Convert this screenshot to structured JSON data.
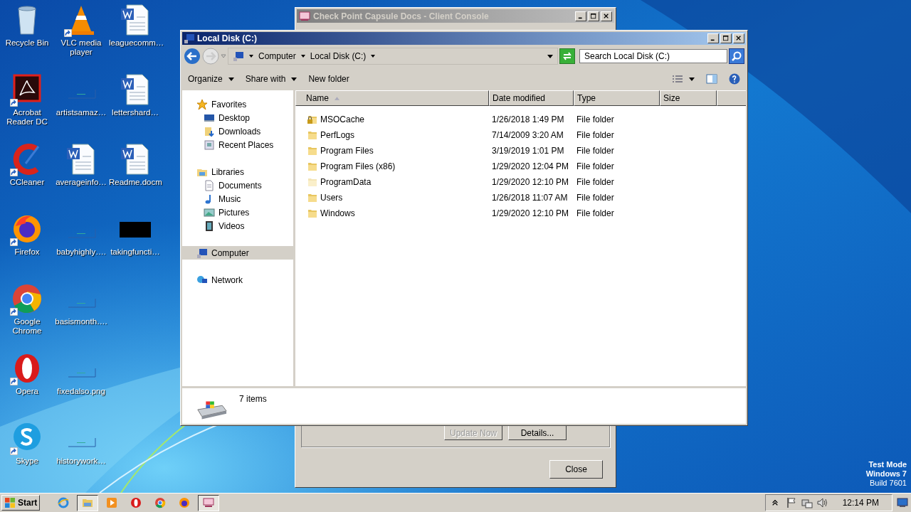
{
  "desktop_icons": [
    {
      "label": "Recycle Bin",
      "kind": "recycle",
      "shortcut": false
    },
    {
      "label": "Acrobat Reader DC",
      "kind": "acrobat",
      "shortcut": true
    },
    {
      "label": "CCleaner",
      "kind": "ccleaner",
      "shortcut": true
    },
    {
      "label": "Firefox",
      "kind": "firefox",
      "shortcut": true
    },
    {
      "label": "Google Chrome",
      "kind": "chrome",
      "shortcut": true
    },
    {
      "label": "Opera",
      "kind": "opera",
      "shortcut": true
    },
    {
      "label": "Skype",
      "kind": "skype",
      "shortcut": true
    },
    {
      "label": "VLC media player",
      "kind": "vlc",
      "shortcut": true
    },
    {
      "label": "artistsamaz…",
      "kind": "blank",
      "shortcut": false
    },
    {
      "label": "averageinfo…",
      "kind": "word",
      "shortcut": false
    },
    {
      "label": "babyhighly….",
      "kind": "blank",
      "shortcut": false
    },
    {
      "label": "basismonth….",
      "kind": "blank",
      "shortcut": false
    },
    {
      "label": "fixedalso.png",
      "kind": "blank",
      "shortcut": false
    },
    {
      "label": "historywork…",
      "kind": "blank",
      "shortcut": false
    },
    {
      "label": "leaguecomm…",
      "kind": "word",
      "shortcut": false
    },
    {
      "label": "lettershard…",
      "kind": "word",
      "shortcut": false
    },
    {
      "label": "Readme.docm",
      "kind": "word",
      "shortcut": false
    },
    {
      "label": "takingfuncti…",
      "kind": "black",
      "shortcut": false
    }
  ],
  "back_window": {
    "title": "Check Point Capsule Docs - Client Console",
    "buttons": [
      {
        "label": "Update Now",
        "disabled": true
      },
      {
        "label": "Details...",
        "disabled": false
      }
    ],
    "close_button": "Close"
  },
  "explorer": {
    "title": "Local Disk (C:)",
    "breadcrumb": [
      "Computer",
      "Local Disk (C:)"
    ],
    "search": {
      "placeholder": "Search Local Disk (C:)"
    },
    "toolbar": [
      {
        "label": "Organize",
        "dropdown": true
      },
      {
        "label": "Share with",
        "dropdown": true
      },
      {
        "label": "New folder",
        "dropdown": false
      }
    ],
    "nav": [
      {
        "label": "Favorites",
        "kind": "star",
        "selected": false,
        "children": [
          {
            "label": "Desktop",
            "kind": "desktop",
            "selected": false
          },
          {
            "label": "Downloads",
            "kind": "downloads",
            "selected": false
          },
          {
            "label": "Recent Places",
            "kind": "recent",
            "selected": false
          }
        ]
      },
      {
        "label": "Libraries",
        "kind": "library",
        "selected": false,
        "children": [
          {
            "label": "Documents",
            "kind": "documents",
            "selected": false
          },
          {
            "label": "Music",
            "kind": "music",
            "selected": false
          },
          {
            "label": "Pictures",
            "kind": "pictures",
            "selected": false
          },
          {
            "label": "Videos",
            "kind": "videos",
            "selected": false
          }
        ]
      },
      {
        "label": "Computer",
        "kind": "computer",
        "selected": true
      },
      {
        "label": "Network",
        "kind": "network",
        "selected": false
      }
    ],
    "columns": [
      {
        "label": "Name",
        "sorted": true
      },
      {
        "label": "Date modified",
        "sorted": false
      },
      {
        "label": "Type",
        "sorted": false
      },
      {
        "label": "Size",
        "sorted": false
      }
    ],
    "rows": [
      {
        "name": "MSOCache",
        "date": "1/26/2018 1:49 PM",
        "type": "File folder",
        "locked": true,
        "hidden": false
      },
      {
        "name": "PerfLogs",
        "date": "7/14/2009 3:20 AM",
        "type": "File folder",
        "locked": false,
        "hidden": false
      },
      {
        "name": "Program Files",
        "date": "3/19/2019 1:01 PM",
        "type": "File folder",
        "locked": false,
        "hidden": false
      },
      {
        "name": "Program Files (x86)",
        "date": "1/29/2020 12:04 PM",
        "type": "File folder",
        "locked": false,
        "hidden": false
      },
      {
        "name": "ProgramData",
        "date": "1/29/2020 12:10 PM",
        "type": "File folder",
        "locked": false,
        "hidden": true
      },
      {
        "name": "Users",
        "date": "1/26/2018 11:07 AM",
        "type": "File folder",
        "locked": false,
        "hidden": false
      },
      {
        "name": "Windows",
        "date": "1/29/2020 12:10 PM",
        "type": "File folder",
        "locked": false,
        "hidden": false
      }
    ],
    "status": "7 items"
  },
  "os_watermark": [
    "Test Mode",
    "Windows 7",
    "Build 7601"
  ],
  "taskbar": {
    "start": "Start",
    "items": [
      {
        "kind": "ie",
        "active": false
      },
      {
        "kind": "explorer",
        "active": true
      },
      {
        "kind": "media",
        "active": false
      },
      {
        "kind": "opera",
        "active": false
      },
      {
        "kind": "chrome",
        "active": false
      },
      {
        "kind": "firefox",
        "active": false
      },
      {
        "kind": "checkpoint",
        "active": true
      }
    ],
    "clock": "12:14 PM"
  }
}
